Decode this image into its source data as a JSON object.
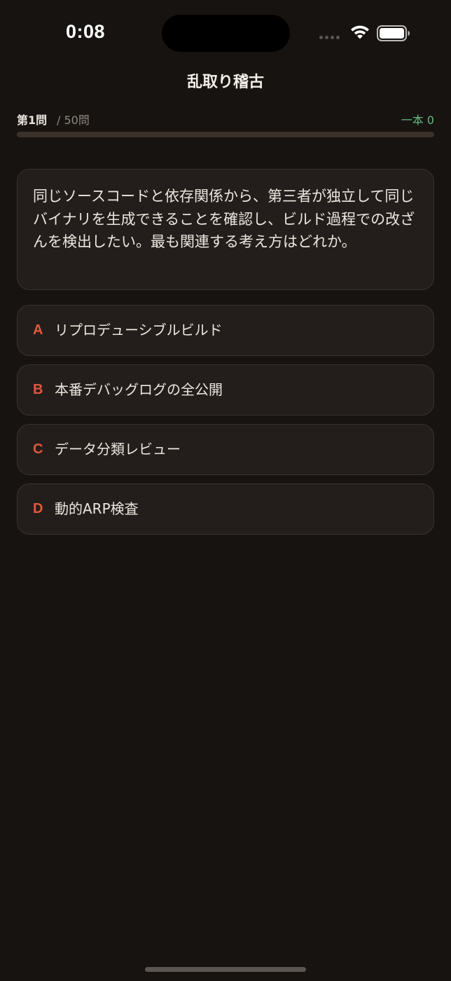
{
  "status_bar": {
    "time": "0:08",
    "wifi_icon": "wifi-icon",
    "battery_icon": "battery-icon"
  },
  "nav": {
    "title": "乱取り稽古"
  },
  "progress": {
    "question_label": "第1問",
    "total_label": "/ 50問",
    "score_label": "一本 0",
    "fraction": 0
  },
  "question": {
    "text": "同じソースコードと依存関係から、第三者が独立して同じバイナリを生成できることを確認し、ビルド過程での改ざんを検出したい。最も関連する考え方はどれか。"
  },
  "choices": [
    {
      "letter": "A",
      "label": "リプロデューシブルビルド"
    },
    {
      "letter": "B",
      "label": "本番デバッグログの全公開"
    },
    {
      "letter": "C",
      "label": "データ分類レビュー"
    },
    {
      "letter": "D",
      "label": "動的ARP検査"
    }
  ],
  "colors": {
    "background": "#171311",
    "card": "#231e1b",
    "accent": "#e1573d",
    "score": "#62b880"
  }
}
